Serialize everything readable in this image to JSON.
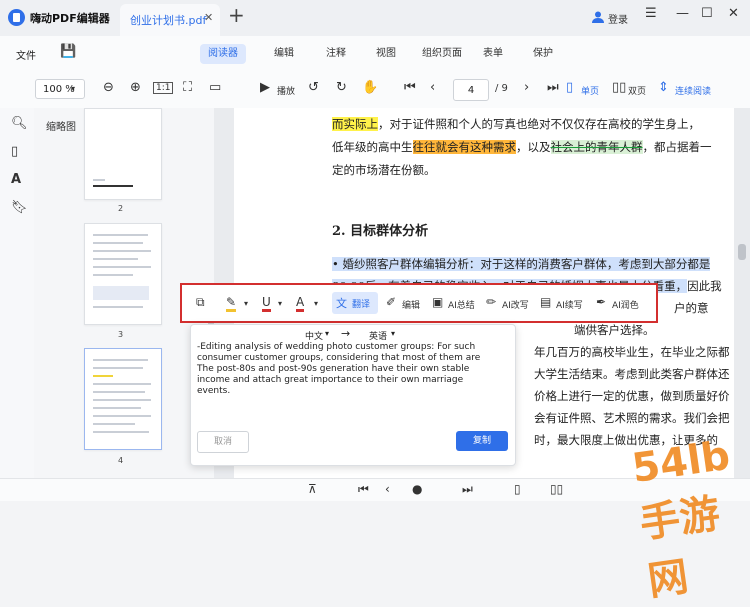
{
  "app": {
    "title": "嗨动PDF编辑器",
    "doc_tab": "创业计划书.pdf",
    "login": "登录"
  },
  "menu": {
    "file": "文件",
    "tabs": [
      "阅读器",
      "编辑",
      "注释",
      "视图",
      "组织页面",
      "表单",
      "保护"
    ],
    "active_tab": "阅读器"
  },
  "toolbar": {
    "zoom": "100 %",
    "fit_label": "1:1",
    "play": "播放",
    "page_current": "4",
    "page_total": "/ 9",
    "single": "单页",
    "double": "双页",
    "continuous": "连续阅读"
  },
  "thumbnails": {
    "title": "缩略图",
    "pages": [
      "2",
      "3",
      "4"
    ]
  },
  "document": {
    "lines": [
      {
        "segs": [
          {
            "t": "而实际上",
            "s": "hl-yellow"
          },
          {
            "t": "，对于证件照和个人的写真也绝对不仅仅存在高校的学生身上，",
            "s": ""
          }
        ]
      },
      {
        "segs": [
          {
            "t": "低年级的高中生",
            "s": ""
          },
          {
            "t": "往往就会有这种需求",
            "s": "hl-orange"
          },
          {
            "t": "，以及",
            "s": ""
          },
          {
            "t": "社会上的青年人群",
            "s": "strike"
          },
          {
            "t": "，都占据着一",
            "s": ""
          }
        ]
      },
      {
        "segs": [
          {
            "t": "定的市场潜在份额。",
            "s": ""
          }
        ]
      }
    ],
    "heading": "2. 目标群体分析",
    "body": [
      {
        "segs": [
          {
            "t": "• 婚纱照客户群体编辑分析：对于这样的消费客户群体，考虑到大部分都是",
            "s": "sel"
          }
        ]
      },
      {
        "segs": [
          {
            "t": "80-90后，有着自己的稳定收入，对于自己的婚姻大事也是十分看重，",
            "s": "sel"
          },
          {
            "t": "因此我",
            "s": ""
          }
        ]
      },
      {
        "segs": [
          {
            "t": "户的意",
            "s": ""
          }
        ]
      },
      {
        "segs": [
          {
            "t": "端供客户选择。",
            "s": ""
          }
        ]
      },
      {
        "segs": [
          {
            "t": "年几百万的高校毕业生，在毕业之际都",
            "s": ""
          }
        ]
      },
      {
        "segs": [
          {
            "t": "大学生活结束。考虑到此类客户群体还",
            "s": ""
          }
        ]
      },
      {
        "segs": [
          {
            "t": "价格上进行一定的优惠，做到质量好价",
            "s": ""
          }
        ]
      },
      {
        "segs": [
          {
            "t": "会有证件照、艺术照的需求。我们会把",
            "s": ""
          }
        ]
      },
      {
        "segs": [
          {
            "t": "时，最大限度上做出优惠，让更多的",
            "s": ""
          }
        ]
      }
    ]
  },
  "float_toolbar": {
    "translate": "翻译",
    "edit": "编辑",
    "ai_summary": "AI总结",
    "ai_rewrite": "AI改写",
    "ai_continue": "AI续写",
    "ai_polish": "AI润色"
  },
  "translation": {
    "src_lang": "中文",
    "arrow": "→",
    "dst_lang": "英语",
    "text": "-Editing analysis of wedding photo customer groups: For such consumer customer groups, considering that most of them are The post-80s and post-90s generation have their own stable income and attach great importance to their own marriage events.",
    "cancel": "取消",
    "copy": "复制"
  },
  "watermark": "54lb手游网"
}
